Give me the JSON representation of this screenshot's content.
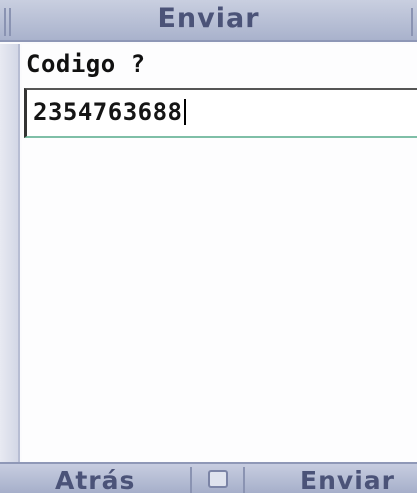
{
  "title": "Enviar",
  "form": {
    "label": "Codigo ?",
    "input_value": "2354763688"
  },
  "softkeys": {
    "left": "Atrás",
    "center_icon": "menu-icon",
    "right": "Enviar"
  },
  "colors": {
    "bar": "#b4bcd4",
    "bar_text": "#4b5378",
    "background": "#fbfbfd",
    "input_underline": "#7fbfa7"
  }
}
